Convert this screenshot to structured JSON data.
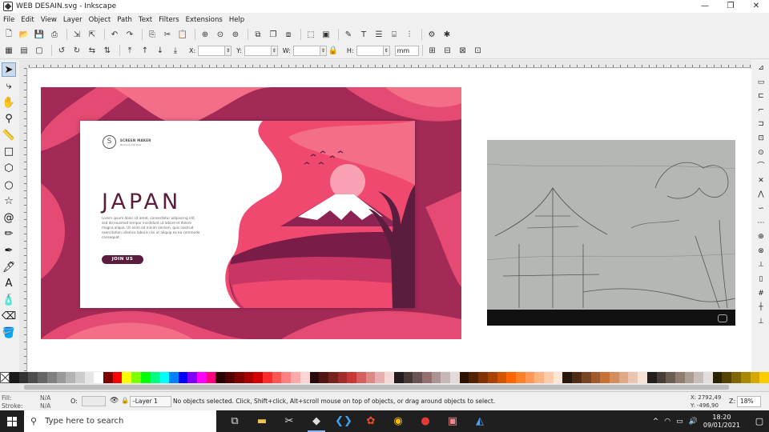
{
  "window": {
    "title": "WEB DESAIN.svg - Inkscape",
    "minimize": "—",
    "maximize": "❐",
    "close": "✕"
  },
  "menu": [
    "File",
    "Edit",
    "View",
    "Layer",
    "Object",
    "Path",
    "Text",
    "Filters",
    "Extensions",
    "Help"
  ],
  "toolbar": {
    "x_label": "X:",
    "y_label": "Y:",
    "w_label": "W:",
    "h_label": "H:",
    "unit": "mm"
  },
  "design": {
    "brand_name": "SCREEN MAKER",
    "brand_tagline": "Bermula Ahli Plus",
    "headline": "JAPAN",
    "body_text": "Lorem ipsum dolor sit amet, consectetur adipiscing elit, sed do eiusmod tempor incididunt ut labore et dolore magna aliqua. Ut enim ad minim veniam, quis nostrud exercitation ullamco laboris nisi ut aliquip ex ea commodo consequat.",
    "cta": "JOIN US",
    "colors": {
      "deep": "#a32a57",
      "mid": "#e44a72",
      "light": "#f36f88",
      "plum": "#5a1d3d",
      "sun": "#f7a1b3"
    }
  },
  "status": {
    "fill_label": "Fill:",
    "stroke_label": "Stroke:",
    "fill_value": "N/A",
    "stroke_value": "N/A",
    "opacity_label": "O:",
    "layer": "-Layer 1",
    "message": "No objects selected. Click, Shift+click, Alt+scroll mouse on top of objects, or drag around objects to select.",
    "x": "X: 2792,49",
    "y": "Y: -496,90",
    "zoom_label": "Z:",
    "zoom": "18%"
  },
  "taskbar": {
    "search_placeholder": "Type here to search",
    "time": "18:20",
    "date": "09/01/2021"
  },
  "palette": [
    "#1a1a1a",
    "#333333",
    "#4d4d4d",
    "#666666",
    "#808080",
    "#999999",
    "#b3b3b3",
    "#cccccc",
    "#e6e6e6",
    "#ffffff",
    "#800000",
    "#ff0000",
    "#ffff00",
    "#80ff00",
    "#00ff00",
    "#00ff80",
    "#00ffff",
    "#0080ff",
    "#0000ff",
    "#8000ff",
    "#ff00ff",
    "#ff0080",
    "#2b0000",
    "#550000",
    "#800000",
    "#aa0000",
    "#d40000",
    "#ff2a2a",
    "#ff5555",
    "#ff8080",
    "#ffaaaa",
    "#ffd5d5",
    "#280b0b",
    "#501616",
    "#782121",
    "#a02c2c",
    "#c83737",
    "#d35f5f",
    "#de8787",
    "#e9afaf",
    "#f4d7d7",
    "#241c1c",
    "#483737",
    "#6c5353",
    "#916f6f",
    "#ac9393",
    "#c8b7b7",
    "#e3dbdb",
    "#2b1100",
    "#552200",
    "#803300",
    "#aa4400",
    "#d45500",
    "#ff6600",
    "#ff7f2a",
    "#ff9955",
    "#ffb380",
    "#ffccaa",
    "#ffe6d5",
    "#28170b",
    "#502d16",
    "#784421",
    "#a05a2c",
    "#c87137",
    "#d38d5f",
    "#deaa87",
    "#e9c6af",
    "#f4e3d7",
    "#241f1c",
    "#483e37",
    "#6c5d53",
    "#917c6f",
    "#ac9d93",
    "#c8beb7",
    "#e3dedb",
    "#2b2200",
    "#554400",
    "#806600",
    "#aa8800",
    "#d4aa00",
    "#ffcc00"
  ]
}
